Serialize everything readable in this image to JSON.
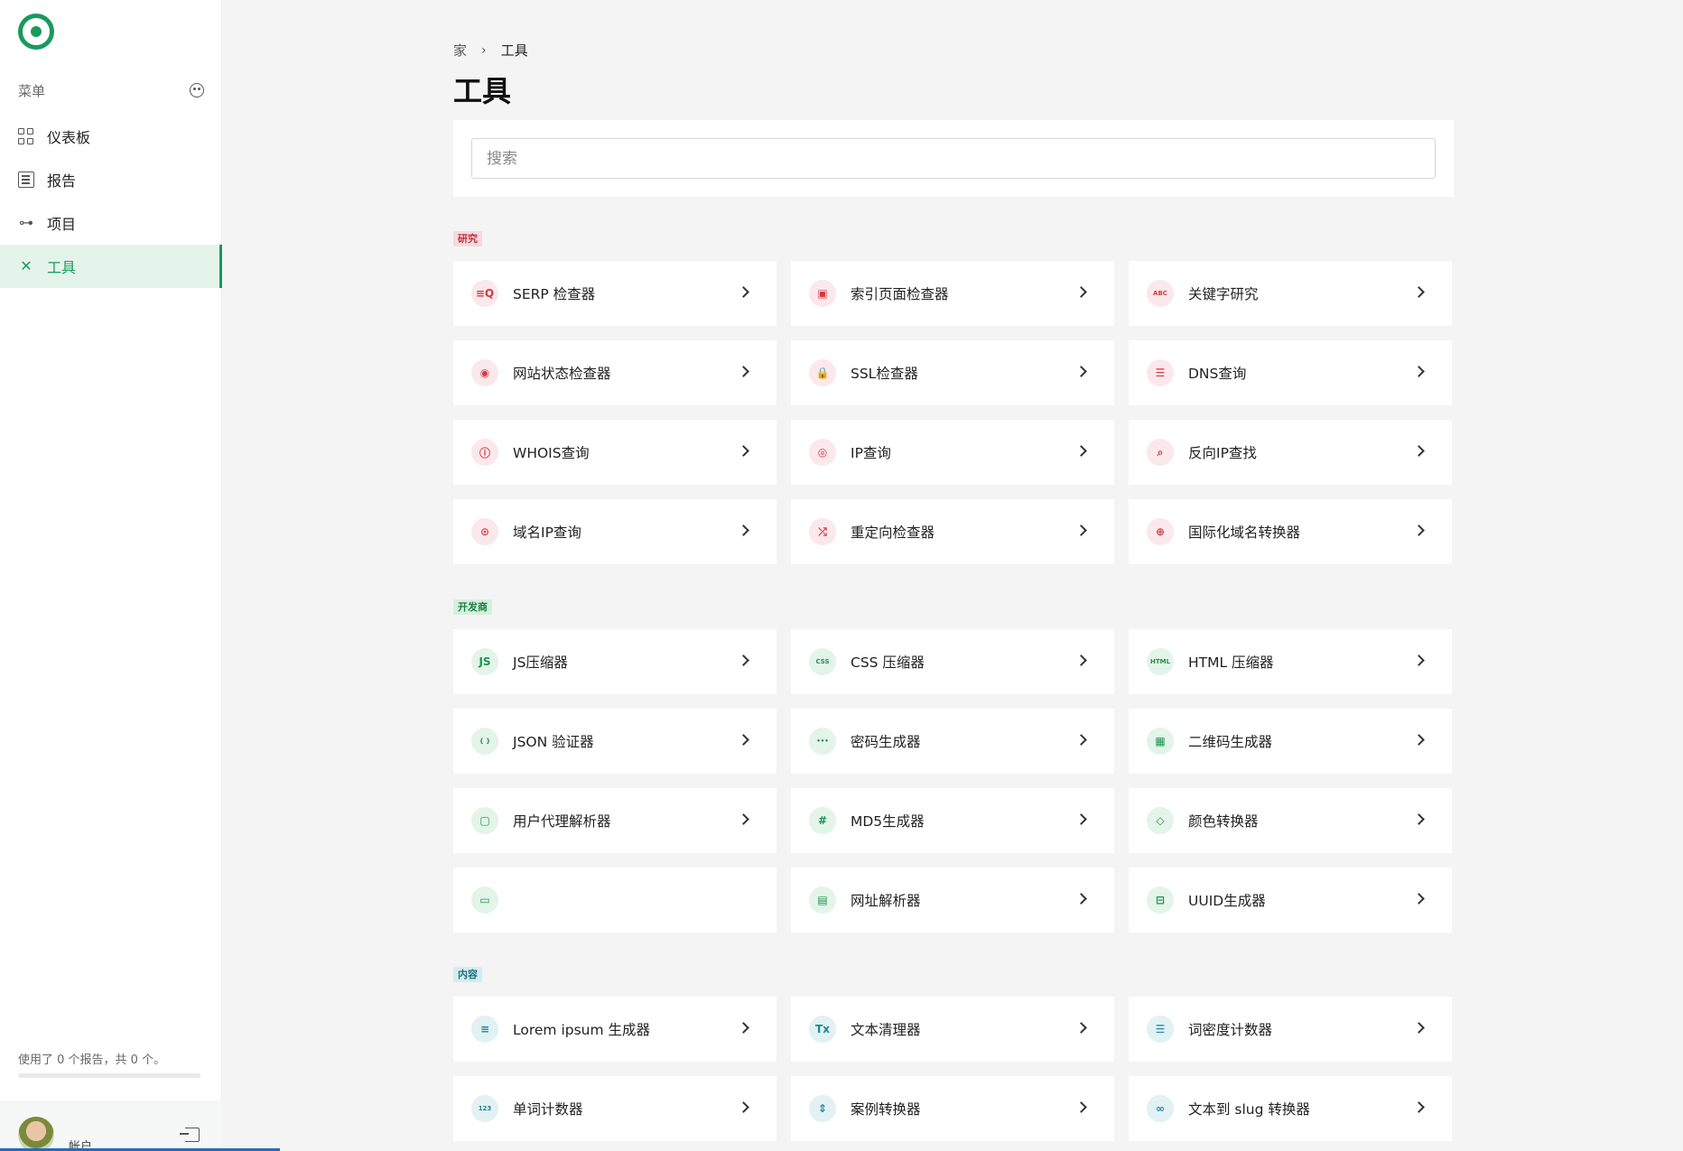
{
  "sidebar": {
    "menu_label": "菜单",
    "items": [
      {
        "label": "仪表板",
        "icon": "grid-icon"
      },
      {
        "label": "报告",
        "icon": "report-icon"
      },
      {
        "label": "项目",
        "icon": "project-icon"
      },
      {
        "label": "工具",
        "icon": "tools-icon",
        "active": true
      }
    ],
    "usage_text": "使用了 0 个报告，共 0 个。",
    "usage_fraction": 0,
    "account_label": "帐户"
  },
  "breadcrumb": {
    "home": "家",
    "current": "工具"
  },
  "page_title": "工具",
  "search": {
    "placeholder": "搜索",
    "value": ""
  },
  "sections": [
    {
      "badge": "研究",
      "color": "#c0343e",
      "tools": [
        {
          "label": "SERP 检查器",
          "glyph": "≡Q",
          "icon": "serp-icon"
        },
        {
          "label": "索引页面检查器",
          "glyph": "▣",
          "icon": "indexed-page-icon"
        },
        {
          "label": "关键字研究",
          "glyph": "ABC",
          "icon": "keyword-icon"
        },
        {
          "label": "网站状态检查器",
          "glyph": "◉",
          "icon": "signal-icon"
        },
        {
          "label": "SSL检查器",
          "glyph": "🔒",
          "icon": "lock-icon"
        },
        {
          "label": "DNS查询",
          "glyph": "☰",
          "icon": "server-icon"
        },
        {
          "label": "WHOIS查询",
          "glyph": "ⓘ",
          "icon": "info-icon"
        },
        {
          "label": "IP查询",
          "glyph": "◎",
          "icon": "ip-lookup-icon"
        },
        {
          "label": "反向IP查找",
          "glyph": "⌕",
          "icon": "search-icon"
        },
        {
          "label": "域名IP查询",
          "glyph": "⊙",
          "icon": "location-icon"
        },
        {
          "label": "重定向检查器",
          "glyph": "⤮",
          "icon": "shuffle-icon"
        },
        {
          "label": "国际化域名转换器",
          "glyph": "⊕",
          "icon": "globe-icon"
        }
      ]
    },
    {
      "badge": "开发商",
      "color": "#1e7e45",
      "tools": [
        {
          "label": "JS压缩器",
          "glyph": "JS",
          "icon": "js-icon"
        },
        {
          "label": "CSS 压缩器",
          "glyph": "CSS",
          "icon": "css-icon"
        },
        {
          "label": "HTML 压缩器",
          "glyph": "HTML",
          "icon": "html-icon"
        },
        {
          "label": "JSON 验证器",
          "glyph": "{ }",
          "icon": "braces-icon"
        },
        {
          "label": "密码生成器",
          "glyph": "•••",
          "icon": "password-icon"
        },
        {
          "label": "二维码生成器",
          "glyph": "▦",
          "icon": "qr-code-icon"
        },
        {
          "label": "用户代理解析器",
          "glyph": "▢",
          "icon": "browser-icon"
        },
        {
          "label": "MD5生成器",
          "glyph": "#",
          "icon": "hash-icon"
        },
        {
          "label": "颜色转换器",
          "glyph": "◇",
          "icon": "color-icon"
        },
        {
          "label": "",
          "glyph": "▭",
          "icon": "tag-icon"
        },
        {
          "label": "网址解析器",
          "glyph": "▤",
          "icon": "url-parser-icon"
        },
        {
          "label": "UUID生成器",
          "glyph": "⊟",
          "icon": "uuid-icon"
        }
      ]
    },
    {
      "badge": "内容",
      "color": "#1f7080",
      "tools": [
        {
          "label": "Lorem ipsum 生成器",
          "glyph": "≡",
          "icon": "text-lines-icon"
        },
        {
          "label": "文本清理器",
          "glyph": "Tx",
          "icon": "clear-format-icon"
        },
        {
          "label": "词密度计数器",
          "glyph": "☰",
          "icon": "list-icon"
        },
        {
          "label": "单词计数器",
          "glyph": "123",
          "icon": "counter-icon"
        },
        {
          "label": "案例转换器",
          "glyph": "⇕",
          "icon": "case-icon"
        },
        {
          "label": "文本到 slug 转换器",
          "glyph": "∞",
          "icon": "link-icon"
        }
      ]
    }
  ]
}
